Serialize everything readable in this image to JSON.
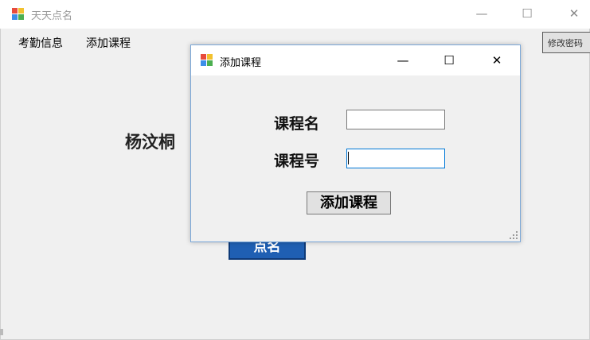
{
  "main_window": {
    "title": "天天点名",
    "minimize_glyph": "—",
    "maximize_glyph": "☐",
    "close_glyph": "✕",
    "menu": [
      "考勤信息",
      "添加课程"
    ],
    "edit_password_button": "修改密码",
    "student_name": "杨汶桐",
    "call_button": "点名"
  },
  "dialog": {
    "title": "添加课程",
    "minimize_glyph": "—",
    "maximize_glyph": "☐",
    "close_glyph": "✕",
    "course_name_label": "课程名",
    "course_name_value": "",
    "course_number_label": "课程号",
    "course_number_value": "",
    "add_button": "添加课程"
  },
  "colors": {
    "window_bg": "#f0f0f0",
    "accent_button": "#1f5fb3",
    "focus_border": "#0078d7"
  }
}
